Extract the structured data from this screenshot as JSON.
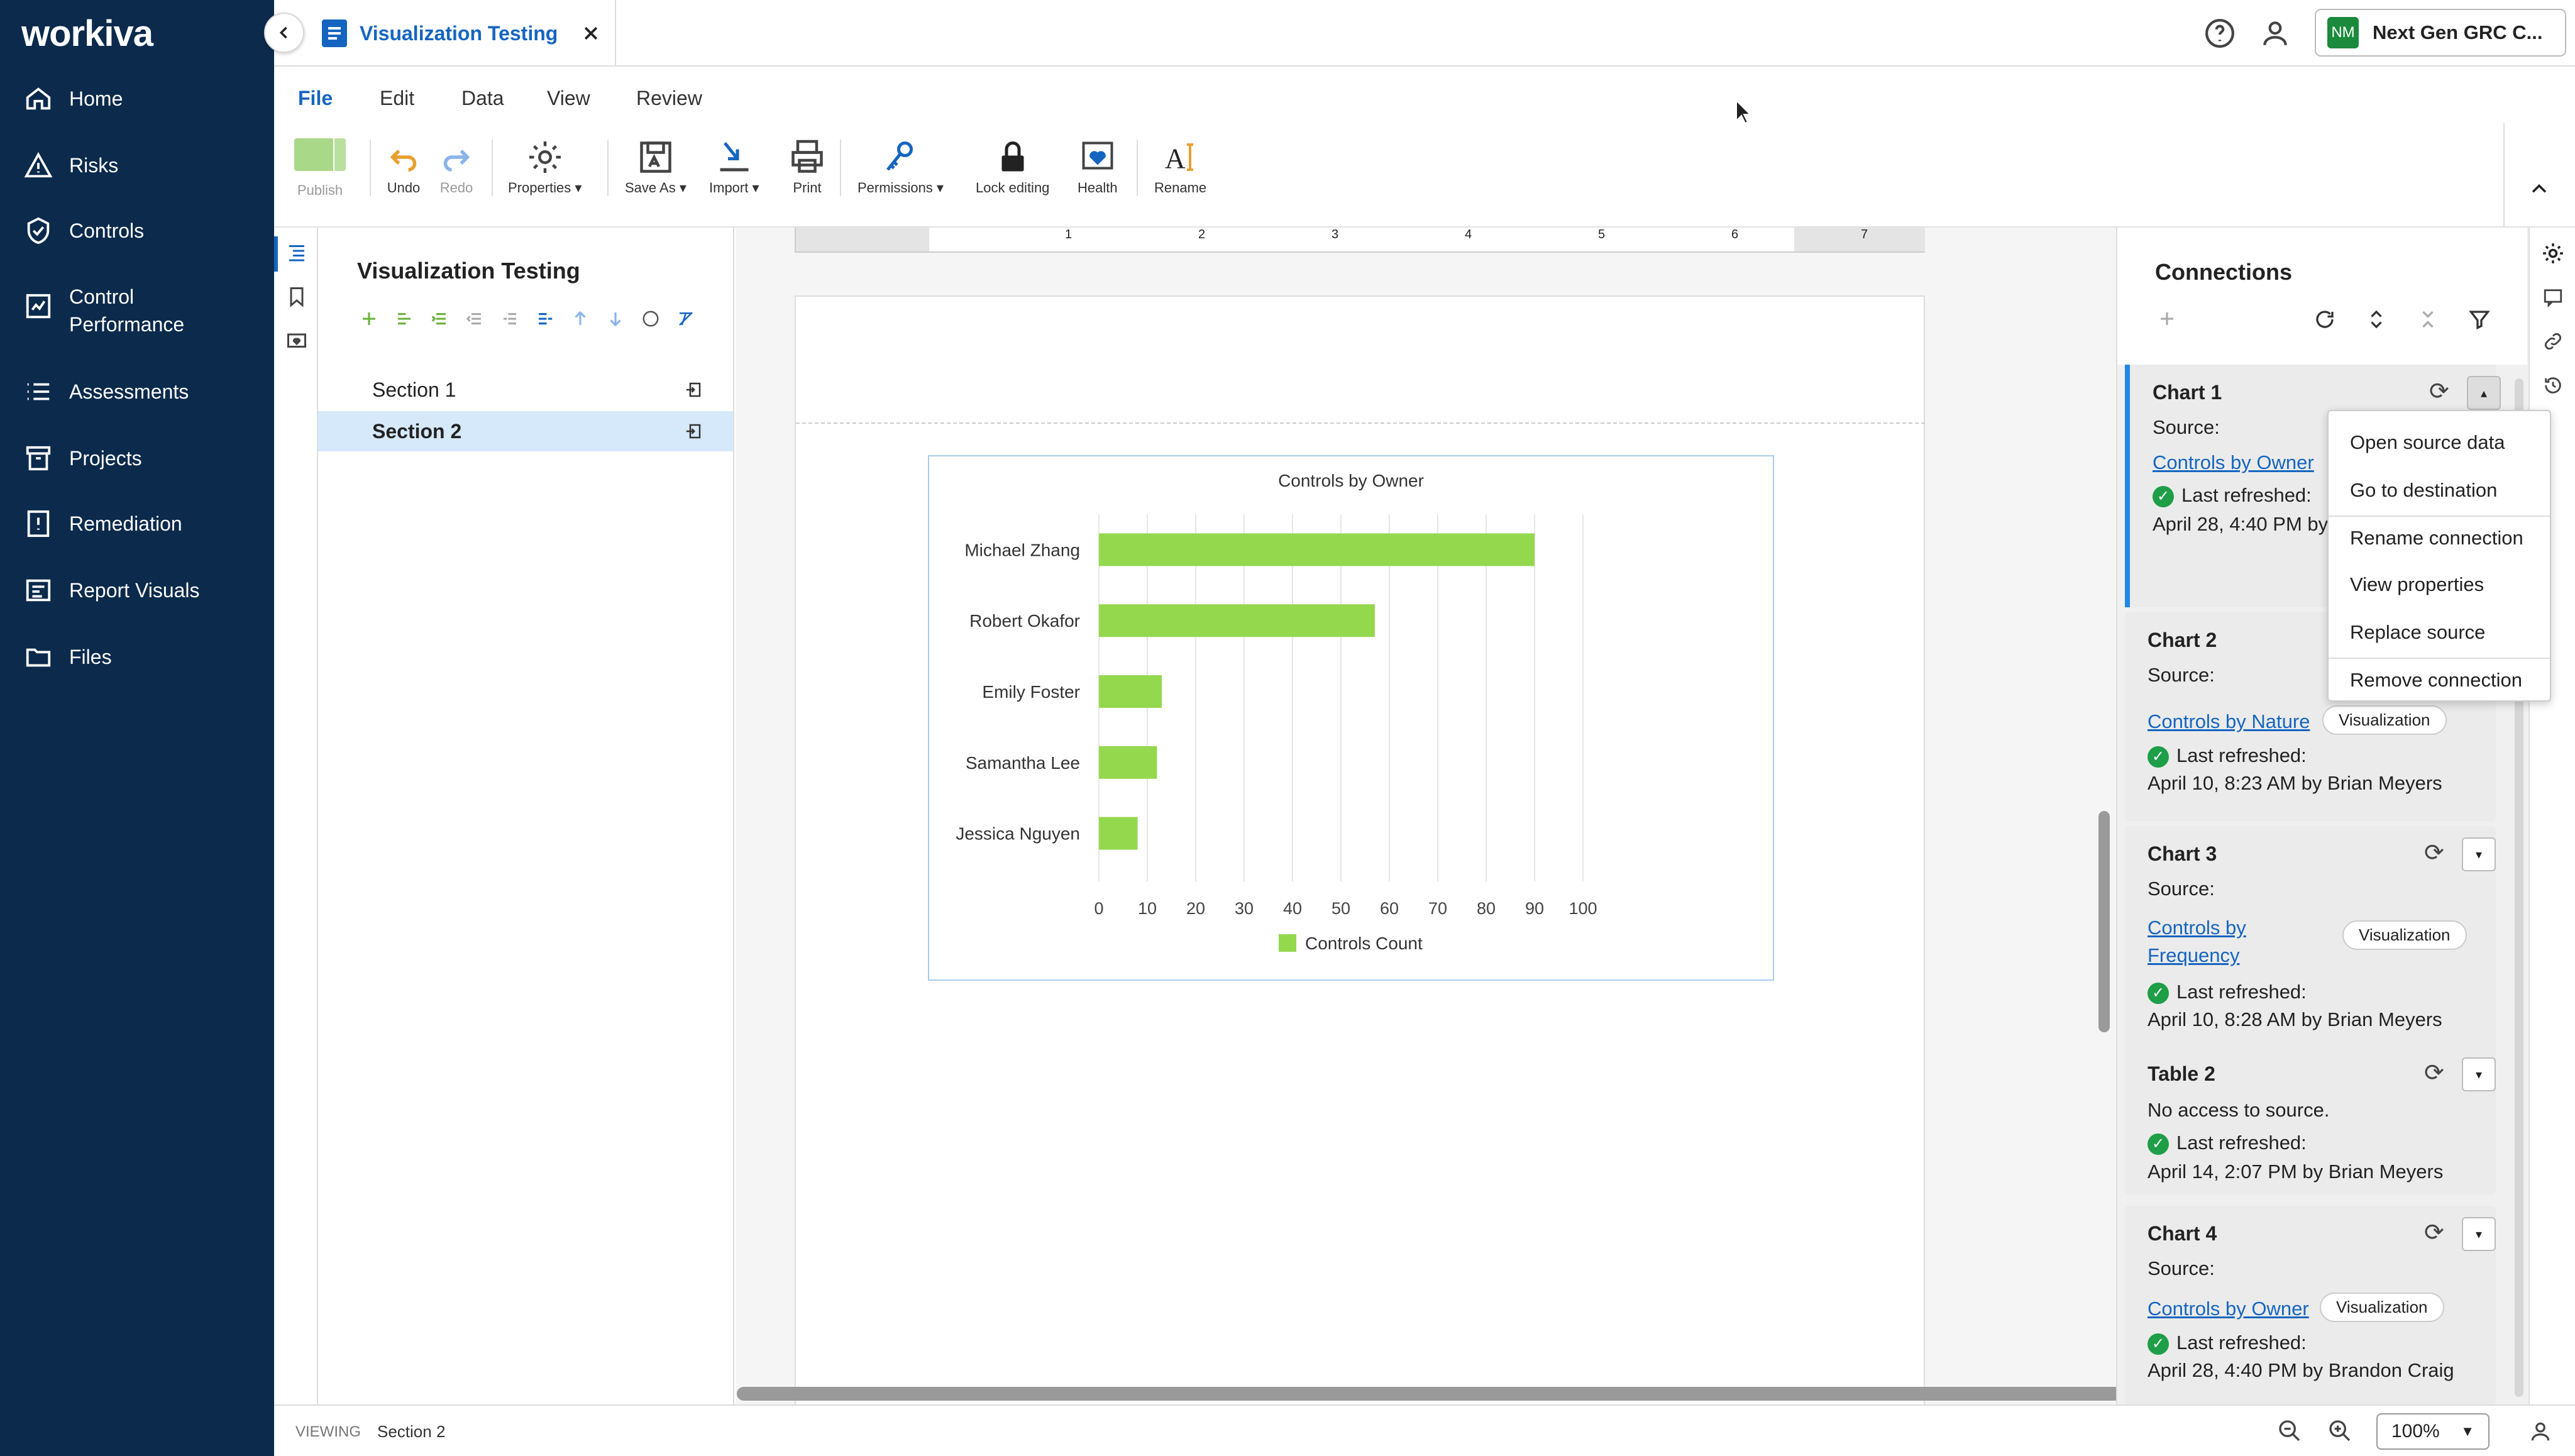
{
  "brand": {
    "logo": "workiva",
    "nav_bg": "#0b2a4c"
  },
  "nav": [
    {
      "label": "Home",
      "icon": "home-icon"
    },
    {
      "label": "Risks",
      "icon": "warning-icon"
    },
    {
      "label": "Controls",
      "icon": "shield-icon"
    },
    {
      "label": "Control\nPerformance",
      "icon": "performance-icon"
    },
    {
      "label": "Assessments",
      "icon": "list-icon"
    },
    {
      "label": "Projects",
      "icon": "archive-icon"
    },
    {
      "label": "Remediation",
      "icon": "alert-doc-icon"
    },
    {
      "label": "Report Visuals",
      "icon": "report-icon"
    },
    {
      "label": "Files",
      "icon": "folder-icon"
    }
  ],
  "tab": {
    "title": "Visualization Testing"
  },
  "user": {
    "initials": "NM",
    "org": "Next Gen GRC C..."
  },
  "menus": [
    "File",
    "Edit",
    "Data",
    "View",
    "Review"
  ],
  "toolbar": {
    "publish": "Publish",
    "undo": "Undo",
    "redo": "Redo",
    "properties": "Properties",
    "save_as": "Save As",
    "import": "Import",
    "print": "Print",
    "permissions": "Permissions",
    "lock": "Lock editing",
    "health": "Health",
    "rename": "Rename"
  },
  "outline": {
    "title": "Visualization Testing",
    "sections": [
      "Section 1",
      "Section 2"
    ],
    "selected": 1
  },
  "ruler": {
    "marks": [
      "1",
      "2",
      "3",
      "4",
      "5",
      "6",
      "7"
    ]
  },
  "chart_data": {
    "type": "bar",
    "orientation": "horizontal",
    "title": "Controls by Owner",
    "categories": [
      "Michael Zhang",
      "Robert Okafor",
      "Emily Foster",
      "Samantha Lee",
      "Jessica Nguyen"
    ],
    "series": [
      {
        "name": "Controls Count",
        "values": [
          90,
          57,
          13,
          12,
          8
        ]
      }
    ],
    "xlim": [
      0,
      100
    ],
    "xticks": [
      0,
      10,
      20,
      30,
      40,
      50,
      60,
      70,
      80,
      90,
      100
    ],
    "color": "#94d84e",
    "grid": true,
    "legend": "bottom"
  },
  "connections": {
    "title": "Connections",
    "cards": [
      {
        "name": "Chart 1",
        "source_label": "Source:",
        "link": "Controls by Owner",
        "refreshed_label": "Last refreshed:",
        "refreshed": "April 28, 4:40 PM by"
      },
      {
        "name": "Chart 2",
        "source_label": "Source:",
        "link": "Controls by Nature",
        "badge": "Visualization",
        "refreshed_label": "Last refreshed:",
        "refreshed": "April 10, 8:23 AM by Brian Meyers"
      },
      {
        "name": "Chart 3",
        "source_label": "Source:",
        "link1": "Controls by",
        "link2": "Frequency",
        "badge": "Visualization",
        "refreshed_label": "Last refreshed:",
        "refreshed": "April 10, 8:28 AM by Brian Meyers"
      },
      {
        "name": "Table 2",
        "note": "No access to source.",
        "refreshed_label": "Last refreshed:",
        "refreshed": "April 14, 2:07 PM by Brian Meyers"
      },
      {
        "name": "Chart 4",
        "source_label": "Source:",
        "link": "Controls by Owner",
        "badge": "Visualization",
        "refreshed_label": "Last refreshed:",
        "refreshed": "April 28, 4:40 PM by Brandon Craig"
      }
    ]
  },
  "context_menu": [
    "Open source data",
    "Go to destination",
    "Rename connection",
    "View properties",
    "Replace source",
    "Remove connection"
  ],
  "status": {
    "viewing_label": "VIEWING",
    "section": "Section 2",
    "zoom": "100%"
  }
}
